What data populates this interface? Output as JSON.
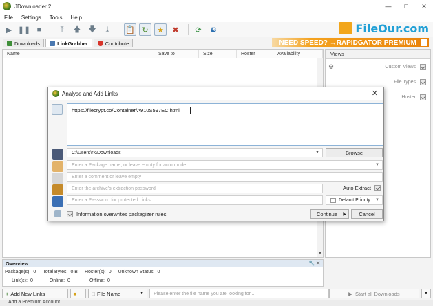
{
  "window": {
    "title": "JDownloader 2",
    "controls": [
      "minimize",
      "maximize",
      "close"
    ]
  },
  "menu": [
    "File",
    "Settings",
    "Tools",
    "Help"
  ],
  "toolbar_icons": [
    "play-icon",
    "pause-icon",
    "stop-icon",
    "move-top-icon",
    "move-up-icon",
    "move-down-icon",
    "move-bottom-icon",
    "clipboard-observer-icon",
    "auto-reconnect-icon",
    "premium-icon",
    "silent-mode-icon",
    "reconnect-icon",
    "update-icon"
  ],
  "watermark": {
    "text": "FileOur.com"
  },
  "tabs": [
    {
      "label": "Downloads",
      "active": false
    },
    {
      "label": "LinkGrabber",
      "active": true
    },
    {
      "label": "Contribute",
      "active": false
    }
  ],
  "promo": {
    "text": "NEED SPEED? →RAPIDGATOR PREMIUM"
  },
  "columns": [
    "Name",
    "Save to",
    "Size",
    "Hoster",
    "Availability"
  ],
  "views": {
    "title": "Views",
    "items": [
      {
        "label": "Custom Views",
        "checked": true
      },
      {
        "label": "File Types",
        "checked": true
      },
      {
        "label": "Hoster",
        "checked": true
      }
    ]
  },
  "dialog": {
    "title": "Analyse and Add Links",
    "links_text": "https://filecrypt.co/Container/A910S597EC.html",
    "save_to": "C:\\Users\\rk\\Downloads",
    "browse_label": "Browse",
    "package_placeholder": "Enter a Package name, or leave empty for auto mode",
    "comment_placeholder": "Enter a comment or leave empty",
    "archive_password_placeholder": "Enter the archive's extraction password",
    "auto_extract_label": "Auto Extract",
    "auto_extract_checked": true,
    "protected_password_placeholder": "Enter a Password for protected Links",
    "priority_label": "Default Priority",
    "overwrite_label": "Information overwrites packagizer rules",
    "overwrite_checked": true,
    "continue_label": "Continue",
    "cancel_label": "Cancel"
  },
  "overview": {
    "title": "Overview",
    "row1": [
      {
        "label": "Package(s):",
        "value": "0"
      },
      {
        "label": "Total Bytes:",
        "value": "0 B"
      },
      {
        "label": "Hoster(s):",
        "value": "0"
      },
      {
        "label": "Unknown Status:",
        "value": "0"
      }
    ],
    "row2": [
      {
        "label": "Link(s):",
        "value": "0"
      },
      {
        "label": "Online:",
        "value": "0"
      },
      {
        "label": "Offline:",
        "value": "0"
      }
    ]
  },
  "bottom": {
    "add_links_label": "Add New Links",
    "filter_label": "File Name",
    "search_placeholder": "Please enter the file name you are looking for...",
    "start_all_label": "Start all Downloads"
  },
  "status": {
    "text": "Add a Premium Account..."
  }
}
